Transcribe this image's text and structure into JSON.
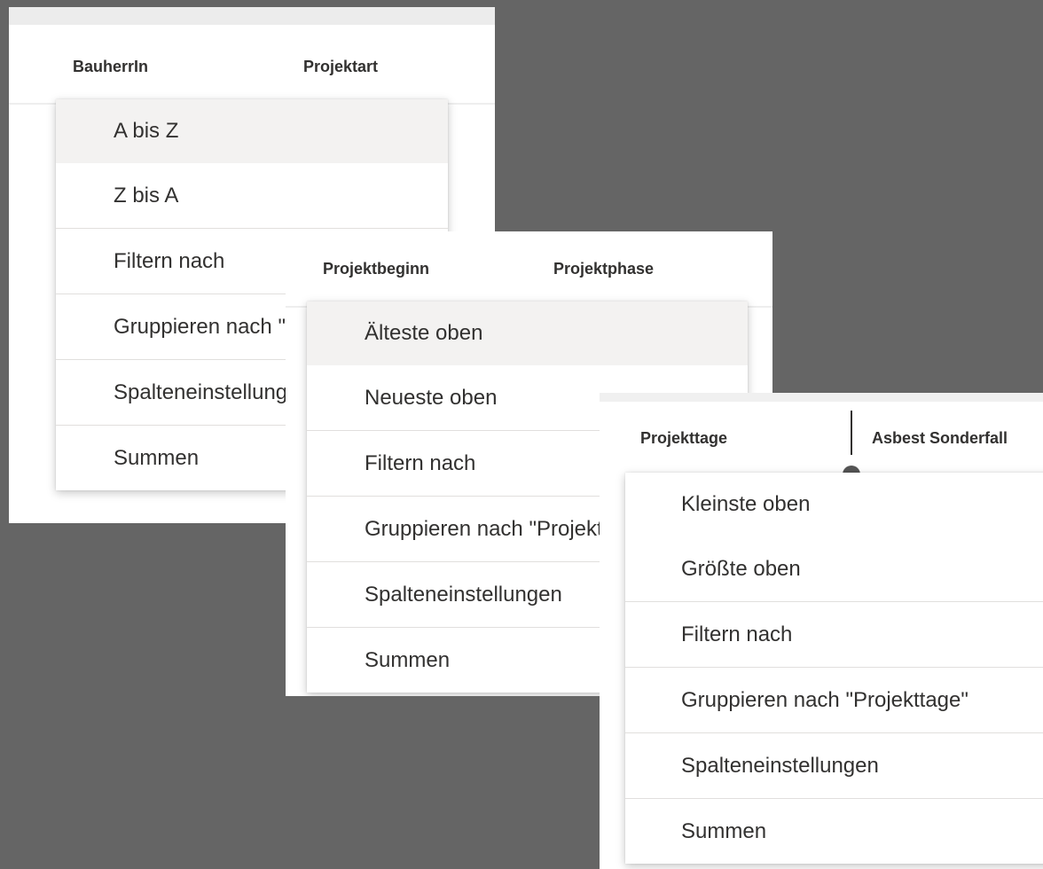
{
  "panel1": {
    "headers": [
      "BauherrIn",
      "Projektart"
    ],
    "menu": [
      {
        "label": "A bis Z",
        "hover": true
      },
      {
        "label": "Z bis A"
      },
      {
        "divider": true
      },
      {
        "label": "Filtern nach"
      },
      {
        "divider": true
      },
      {
        "label": "Gruppieren nach \"BauherrIn\""
      },
      {
        "divider": true
      },
      {
        "label": "Spalteneinstellungen",
        "chevron": true
      },
      {
        "divider": true
      },
      {
        "label": "Summen",
        "chevron": true
      }
    ]
  },
  "panel2": {
    "headers": [
      "Projektbeginn",
      "Projektphase"
    ],
    "menu": [
      {
        "label": "Älteste oben",
        "hover": true
      },
      {
        "label": "Neueste oben"
      },
      {
        "divider": true
      },
      {
        "label": "Filtern nach"
      },
      {
        "divider": true
      },
      {
        "label": "Gruppieren nach \"Projektbeginn\""
      },
      {
        "divider": true
      },
      {
        "label": "Spalteneinstellungen",
        "chevron": true
      },
      {
        "divider": true
      },
      {
        "label": "Summen",
        "chevron": true
      }
    ]
  },
  "panel3": {
    "headers": [
      "Projekttage",
      "Asbest Sonderfall"
    ],
    "menu": [
      {
        "label": "Kleinste oben"
      },
      {
        "label": "Größte oben"
      },
      {
        "divider": true
      },
      {
        "label": "Filtern nach"
      },
      {
        "divider": true
      },
      {
        "label": "Gruppieren nach \"Projekttage\""
      },
      {
        "divider": true
      },
      {
        "label": "Spalteneinstellungen",
        "chevron": true
      },
      {
        "divider": true
      },
      {
        "label": "Summen",
        "chevron": true
      }
    ]
  },
  "icons": {
    "chevron": "›"
  },
  "colors": {
    "background": "#656565",
    "panel": "#ffffff",
    "hover": "#f3f2f1",
    "text": "#323130",
    "divider": "#e1dfdd"
  }
}
